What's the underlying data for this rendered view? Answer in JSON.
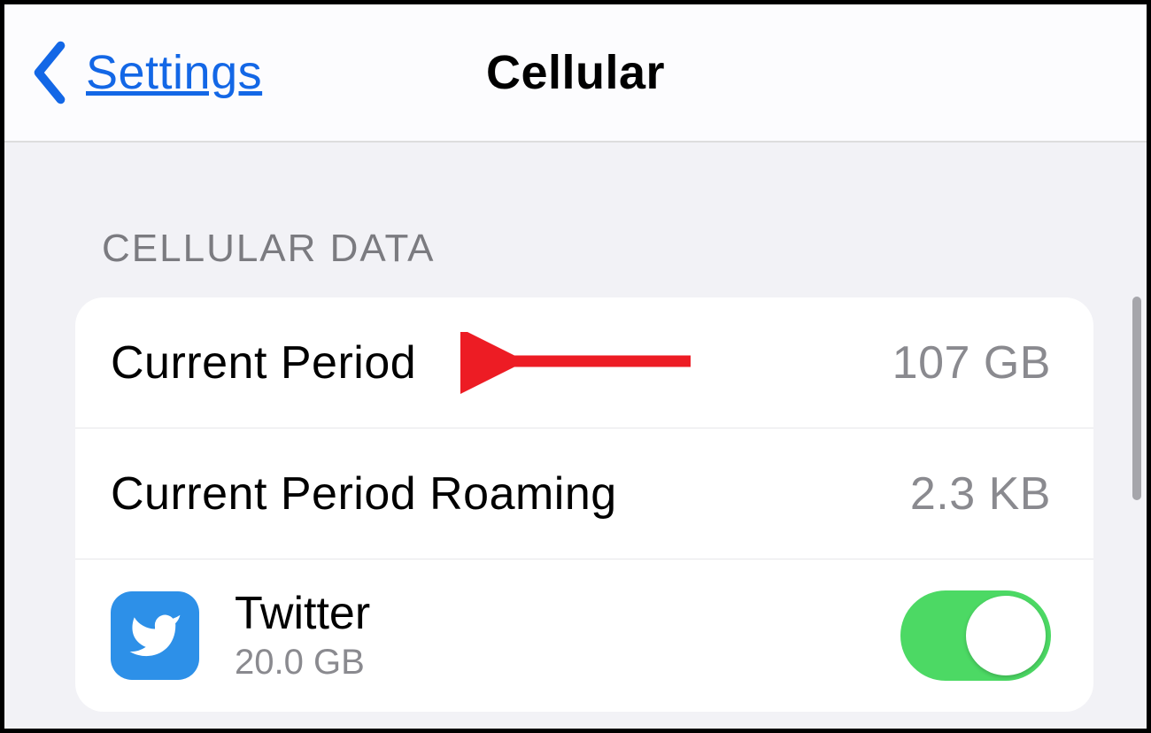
{
  "navbar": {
    "back_label": "Settings",
    "title": "Cellular"
  },
  "section_header": "CELLULAR DATA",
  "rows": {
    "current_period": {
      "label": "Current Period",
      "value": "107 GB"
    },
    "roaming": {
      "label": "Current Period Roaming",
      "value": "2.3 KB"
    }
  },
  "apps": {
    "twitter": {
      "name": "Twitter",
      "usage": "20.0 GB",
      "toggle": true
    }
  },
  "colors": {
    "ios_blue": "#1367e6",
    "twitter_blue": "#2d90e8",
    "toggle_green": "#4cd964",
    "arrow_red": "#ed1c24"
  }
}
